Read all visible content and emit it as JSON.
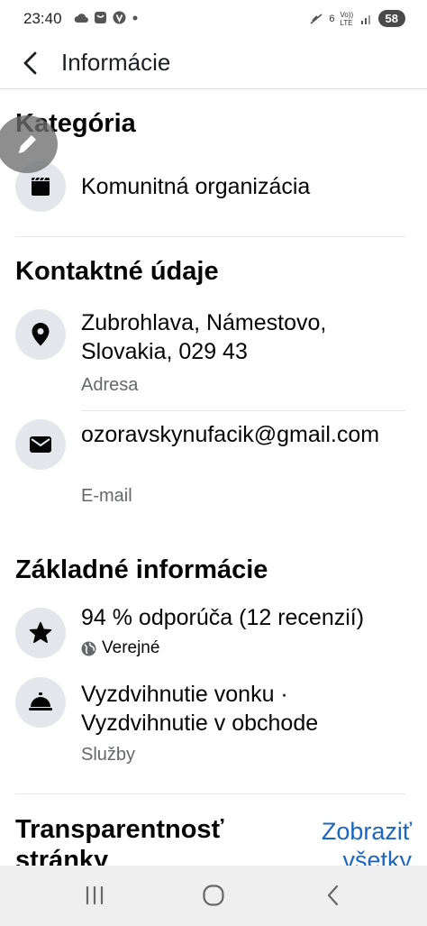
{
  "status_bar": {
    "time": "23:40",
    "network_label": "Vo)) LTE",
    "signal_label": "6",
    "battery": "58"
  },
  "header": {
    "title": "Informácie"
  },
  "sections": {
    "category": {
      "title": "Kategória",
      "item": "Komunitná organizácia"
    },
    "contact": {
      "title": "Kontaktné údaje",
      "address": "Zubrohlava, Námestovo, Slovakia, 029 43",
      "address_label": "Adresa",
      "email": "ozoravskynufacik@gmail.com",
      "email_label": "E-mail"
    },
    "basic": {
      "title": "Základné informácie",
      "rating": "94 % odporúča (12 recenzií)",
      "rating_visibility": "Verejné",
      "services": "Vyzdvihnutie vonku · Vyzdvihnutie v obchode",
      "services_label": "Služby"
    },
    "transparency": {
      "title": "Transparentnosť stránky",
      "see_all": "Zobraziť všetky"
    }
  },
  "icons": {
    "back": "back-arrow-icon",
    "edit": "pencil-icon",
    "category": "clapperboard-icon",
    "address": "location-pin-icon",
    "email": "envelope-icon",
    "rating": "star-icon",
    "globe": "globe-icon",
    "services": "service-bell-icon"
  },
  "colors": {
    "link": "#1a66c2",
    "secondary_text": "#65676b",
    "icon_bg": "#e4e6eb"
  }
}
